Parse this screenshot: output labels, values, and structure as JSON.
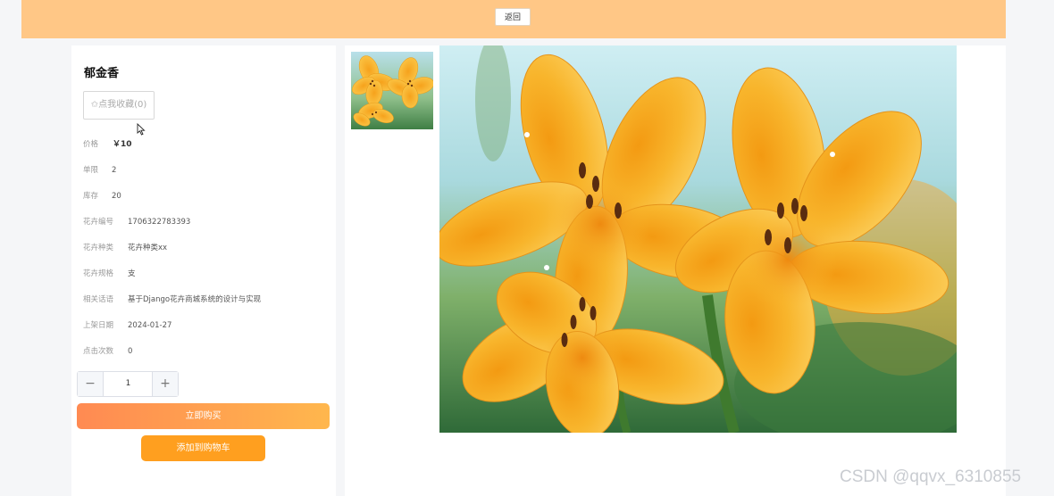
{
  "header": {
    "back_label": "返回"
  },
  "product": {
    "title": "郁金香",
    "favorite_star": "✩",
    "favorite_label": "点我收藏(0)",
    "fields": [
      {
        "label": "价格",
        "value": "￥10"
      },
      {
        "label": "单限",
        "value": "2"
      },
      {
        "label": "库存",
        "value": "20"
      },
      {
        "label": "花卉编号",
        "value": "1706322783393"
      },
      {
        "label": "花卉种类",
        "value": "花卉种类xx"
      },
      {
        "label": "花卉规格",
        "value": "支"
      },
      {
        "label": "相关话语",
        "value": "基于Django花卉商城系统的设计与实现"
      },
      {
        "label": "上架日期",
        "value": "2024-01-27"
      },
      {
        "label": "点击次数",
        "value": "0"
      }
    ],
    "quantity": {
      "minus": "−",
      "value": "1",
      "plus": "+"
    },
    "buy_now_label": "立即购买",
    "add_to_cart_label": "添加到购物车"
  },
  "gallery": {
    "thumbnail": "yellow-lily-photo",
    "main_image": "yellow-lily-photo"
  },
  "watermark": "CSDN @qqvx_6310855",
  "colors": {
    "header_bg": "#ffc786",
    "buy_gradient_start": "#ff8a52",
    "buy_gradient_end": "#ffb74d",
    "cart_bg": "#ff9f1f"
  }
}
